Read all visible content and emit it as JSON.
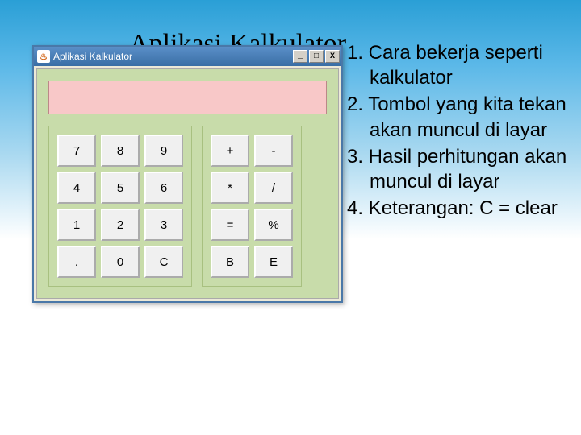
{
  "slide": {
    "title": "Aplikasi Kalkulator"
  },
  "window": {
    "title": "Aplikasi Kalkulator",
    "buttons": {
      "min": "_",
      "max": "□",
      "close": "X"
    }
  },
  "keys": {
    "num": [
      "7",
      "8",
      "9",
      "4",
      "5",
      "6",
      "1",
      "2",
      "3",
      ".",
      "0",
      "C"
    ],
    "op": [
      "+",
      "-",
      "*",
      "/",
      "=",
      "%",
      "B",
      "E"
    ]
  },
  "notes": {
    "items": [
      "1. Cara bekerja seperti kalkulator",
      "2. Tombol yang kita tekan akan muncul di layar",
      "3. Hasil perhitungan akan muncul di layar",
      "4. Keterangan: C  = clear"
    ]
  }
}
